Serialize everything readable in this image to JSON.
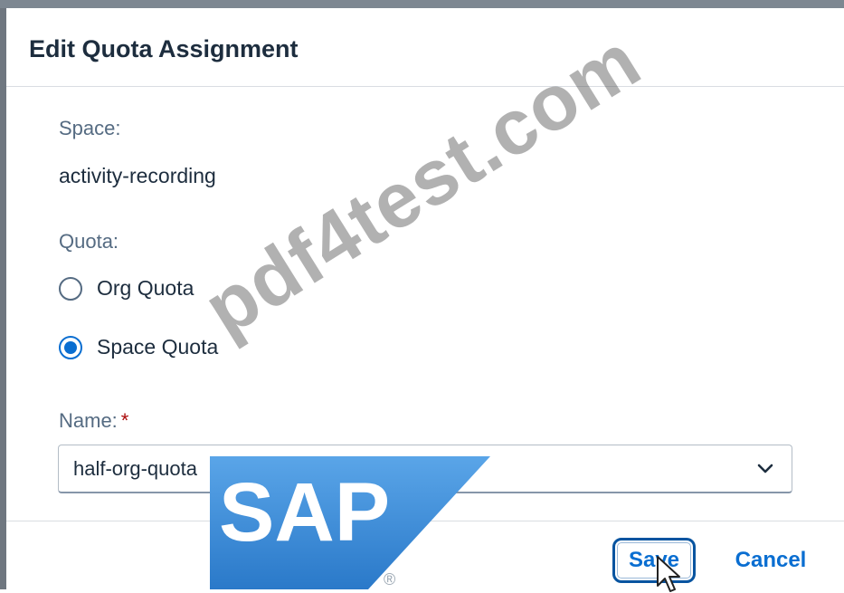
{
  "dialog": {
    "title": "Edit Quota Assignment",
    "space_label": "Space:",
    "space_value": "activity-recording",
    "quota_label": "Quota:",
    "quota_options": [
      {
        "label": "Org Quota",
        "selected": false
      },
      {
        "label": "Space Quota",
        "selected": true
      }
    ],
    "name_label": "Name:",
    "required_marker": "*",
    "name_value": "half-org-quota",
    "save_label": "Save",
    "cancel_label": "Cancel"
  },
  "overlay": {
    "watermark_text": "pdf4test.com",
    "logo_text": "SAP",
    "logo_mark": "®"
  },
  "colors": {
    "accent": "#0a6ed1",
    "text": "#1d2d3e",
    "label": "#556b82",
    "required": "#aa0808",
    "sap_blue": "#3a8ad8"
  },
  "icons": [
    "chevron-down-icon",
    "mouse-pointer-icon",
    "sap-logo"
  ]
}
